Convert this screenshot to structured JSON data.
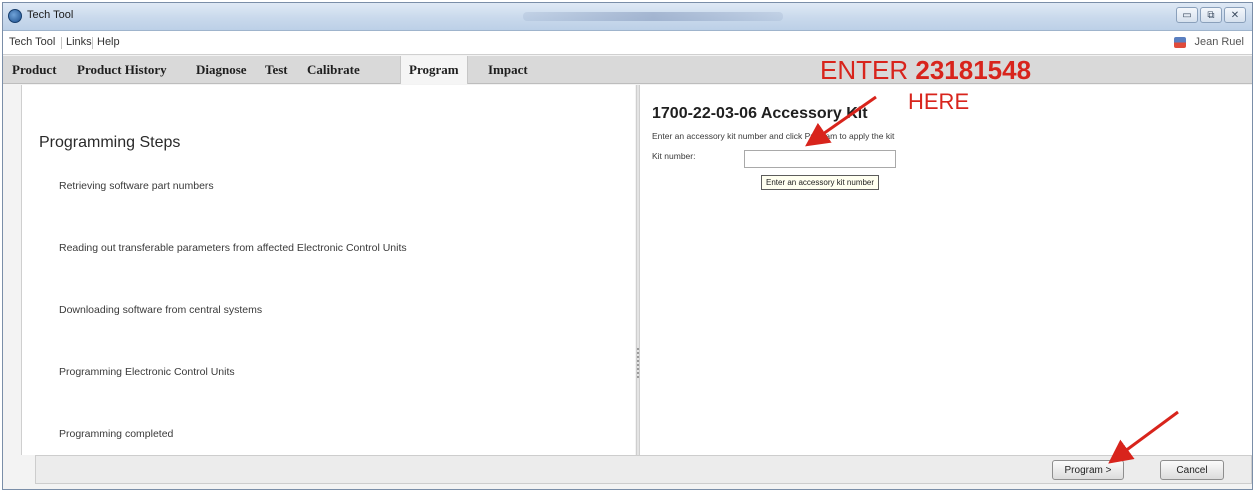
{
  "window": {
    "title": "Tech Tool",
    "buttons": {
      "minimize": "▭",
      "restore": "⧉",
      "close": "✕"
    }
  },
  "menu": {
    "items": [
      "Tech Tool",
      "Links",
      "Help"
    ],
    "user": "Jean Ruel"
  },
  "tabs": [
    "Product",
    "Product History",
    "Diagnose",
    "Test",
    "Calibrate",
    "Program",
    "Impact"
  ],
  "active_tab": "Program",
  "annotation": {
    "enter_prefix": "ENTER",
    "enter_number": "23181548",
    "here": "HERE",
    "color": "#d8241c"
  },
  "programming": {
    "title": "Programming Steps",
    "steps": [
      "Retrieving software part numbers",
      "Reading out transferable parameters from affected Electronic Control Units",
      "Downloading software from central systems",
      "Programming Electronic Control Units",
      "Programming completed"
    ]
  },
  "kit": {
    "title": "1700-22-03-06 Accessory Kit",
    "instruction": "Enter an accessory kit number and click Program to apply the kit",
    "label": "Kit number:",
    "value": "",
    "tooltip": "Enter an accessory kit number"
  },
  "footer": {
    "program_label": "Program >",
    "cancel_label": "Cancel"
  }
}
